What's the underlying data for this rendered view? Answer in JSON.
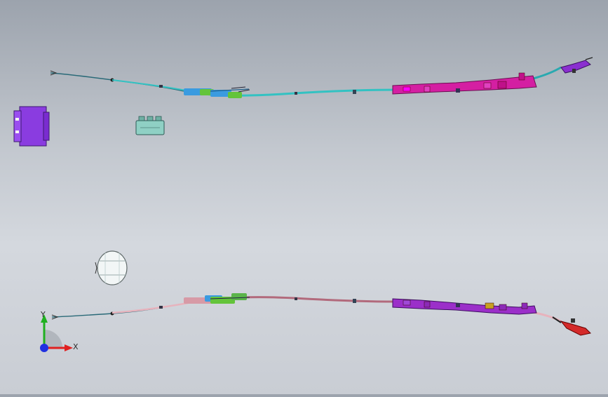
{
  "triad": {
    "x_label": "X",
    "y_label": "Y",
    "x_color": "#e02020",
    "y_color": "#20b020",
    "z_color": "#2030e0"
  },
  "colors": {
    "cable_top": "#33c2c2",
    "cable_bottom": "#d79aa6",
    "clip_green": "#63c43a",
    "clip_blue": "#3a9be0",
    "bracket_magenta": "#d41fa2",
    "bracket_purple": "#9b2fc9",
    "end_fitting_red": "#d42a2a",
    "module_purple": "#8a3ce0",
    "module_teal": "#8fd0c4",
    "module_white": "#f2f6f6"
  },
  "icons": [
    "triad-axes-icon"
  ]
}
